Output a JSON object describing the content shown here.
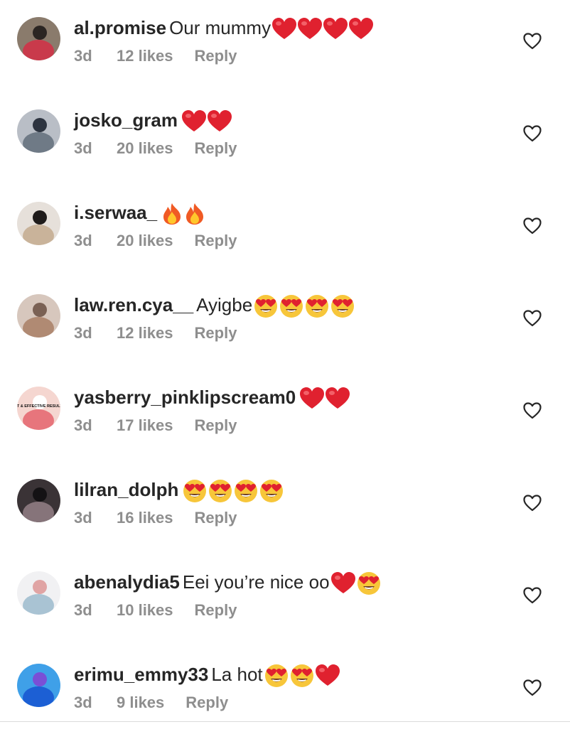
{
  "comments": [
    {
      "username": "al.promise",
      "text": "Our mummy",
      "emojis": [
        "red-heart",
        "red-heart",
        "red-heart",
        "red-heart"
      ],
      "time": "3d",
      "likes": "12 likes",
      "reply": "Reply",
      "avatar_colors": [
        "#8a7b6c",
        "#c93a4b",
        "#2b2522"
      ]
    },
    {
      "username": "josko_gram",
      "text": "",
      "emojis": [
        "red-heart",
        "red-heart"
      ],
      "time": "3d",
      "likes": "20 likes",
      "reply": "Reply",
      "avatar_colors": [
        "#b9bec6",
        "#6f7a86",
        "#2d3440"
      ]
    },
    {
      "username": "i.serwaa_",
      "text": "",
      "emojis": [
        "fire",
        "fire"
      ],
      "time": "3d",
      "likes": "20 likes",
      "reply": "Reply",
      "avatar_colors": [
        "#e6e0da",
        "#c9b39a",
        "#1f1b1a"
      ]
    },
    {
      "username": "law.ren.cya__",
      "text": "Ayigbe",
      "emojis": [
        "heart-eyes",
        "heart-eyes",
        "heart-eyes",
        "heart-eyes"
      ],
      "time": "3d",
      "likes": "12 likes",
      "reply": "Reply",
      "avatar_colors": [
        "#d7c7bd",
        "#b08a73",
        "#7a6154"
      ]
    },
    {
      "username": "yasberry_pinklipscream0",
      "text": "",
      "emojis": [
        "red-heart",
        "red-heart"
      ],
      "time": "3d",
      "likes": "17 likes",
      "reply": "Reply",
      "avatar_colors": [
        "#f5d6d0",
        "#e7757c",
        "#ffffff"
      ],
      "avatar_label": "FAST & EFFECTIVE RESULTS!!"
    },
    {
      "username": "lilran_dolph",
      "text": "",
      "emojis": [
        "heart-eyes",
        "heart-eyes",
        "heart-eyes",
        "heart-eyes"
      ],
      "time": "3d",
      "likes": "16 likes",
      "reply": "Reply",
      "avatar_colors": [
        "#3a3336",
        "#86747a",
        "#141214"
      ]
    },
    {
      "username": "abenalydia5",
      "text": "Eei you’re nice oo",
      "emojis": [
        "red-heart",
        "heart-eyes"
      ],
      "time": "3d",
      "likes": "10 likes",
      "reply": "Reply",
      "avatar_colors": [
        "#f1f1f3",
        "#a9c3d3",
        "#e0a4a4"
      ]
    },
    {
      "username": "erimu_emmy33",
      "text": "La hot",
      "emojis": [
        "heart-eyes",
        "heart-eyes",
        "red-heart"
      ],
      "time": "3d",
      "likes": "9 likes",
      "reply": "Reply",
      "avatar_colors": [
        "#3fa0e8",
        "#1c5fd4",
        "#7a4fd6"
      ]
    }
  ],
  "like_button_icon": "heart-outline-icon",
  "colors": {
    "username": "#262626",
    "meta": "#8e8e8e",
    "heart_red": "#e0212f",
    "emoji_yellow": "#f7c63a"
  }
}
